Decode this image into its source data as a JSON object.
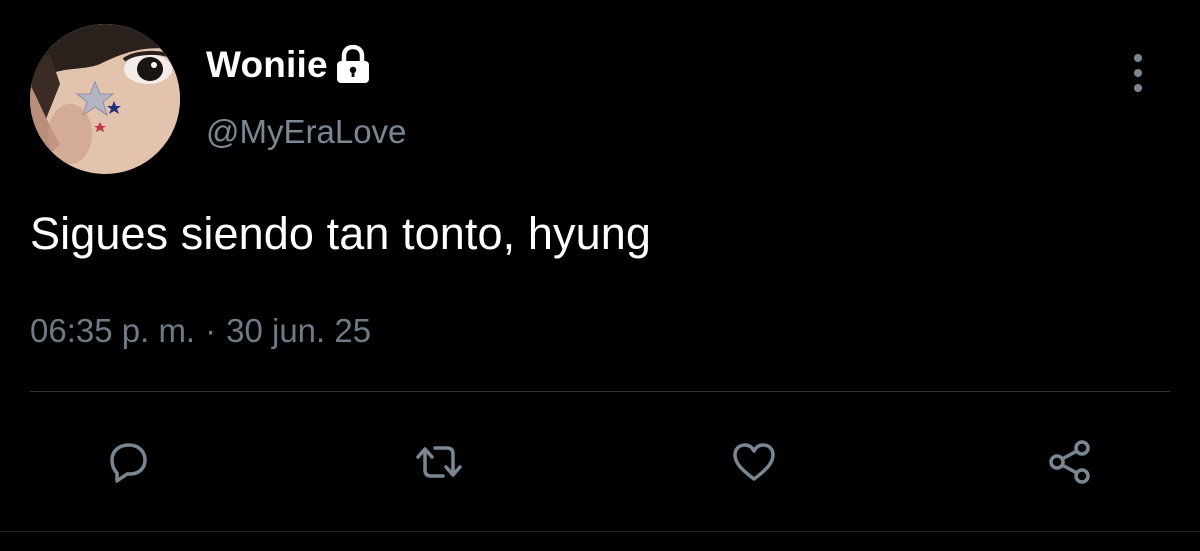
{
  "tweet": {
    "display_name": "Woniie",
    "handle": "@MyEraLove",
    "text": "Sigues siendo tan tonto, hyung",
    "time": "06:35 p. m.",
    "separator": "·",
    "date": "30 jun. 25"
  },
  "icons": {
    "lock": "lock-icon",
    "more": "more-vertical-icon",
    "reply": "reply-icon",
    "retweet": "retweet-icon",
    "like": "heart-icon",
    "share": "share-icon"
  },
  "colors": {
    "background": "#000000",
    "primary_text": "#ffffff",
    "secondary_text": "#7a8793",
    "icon": "#7a8793",
    "divider": "#2f3336"
  }
}
